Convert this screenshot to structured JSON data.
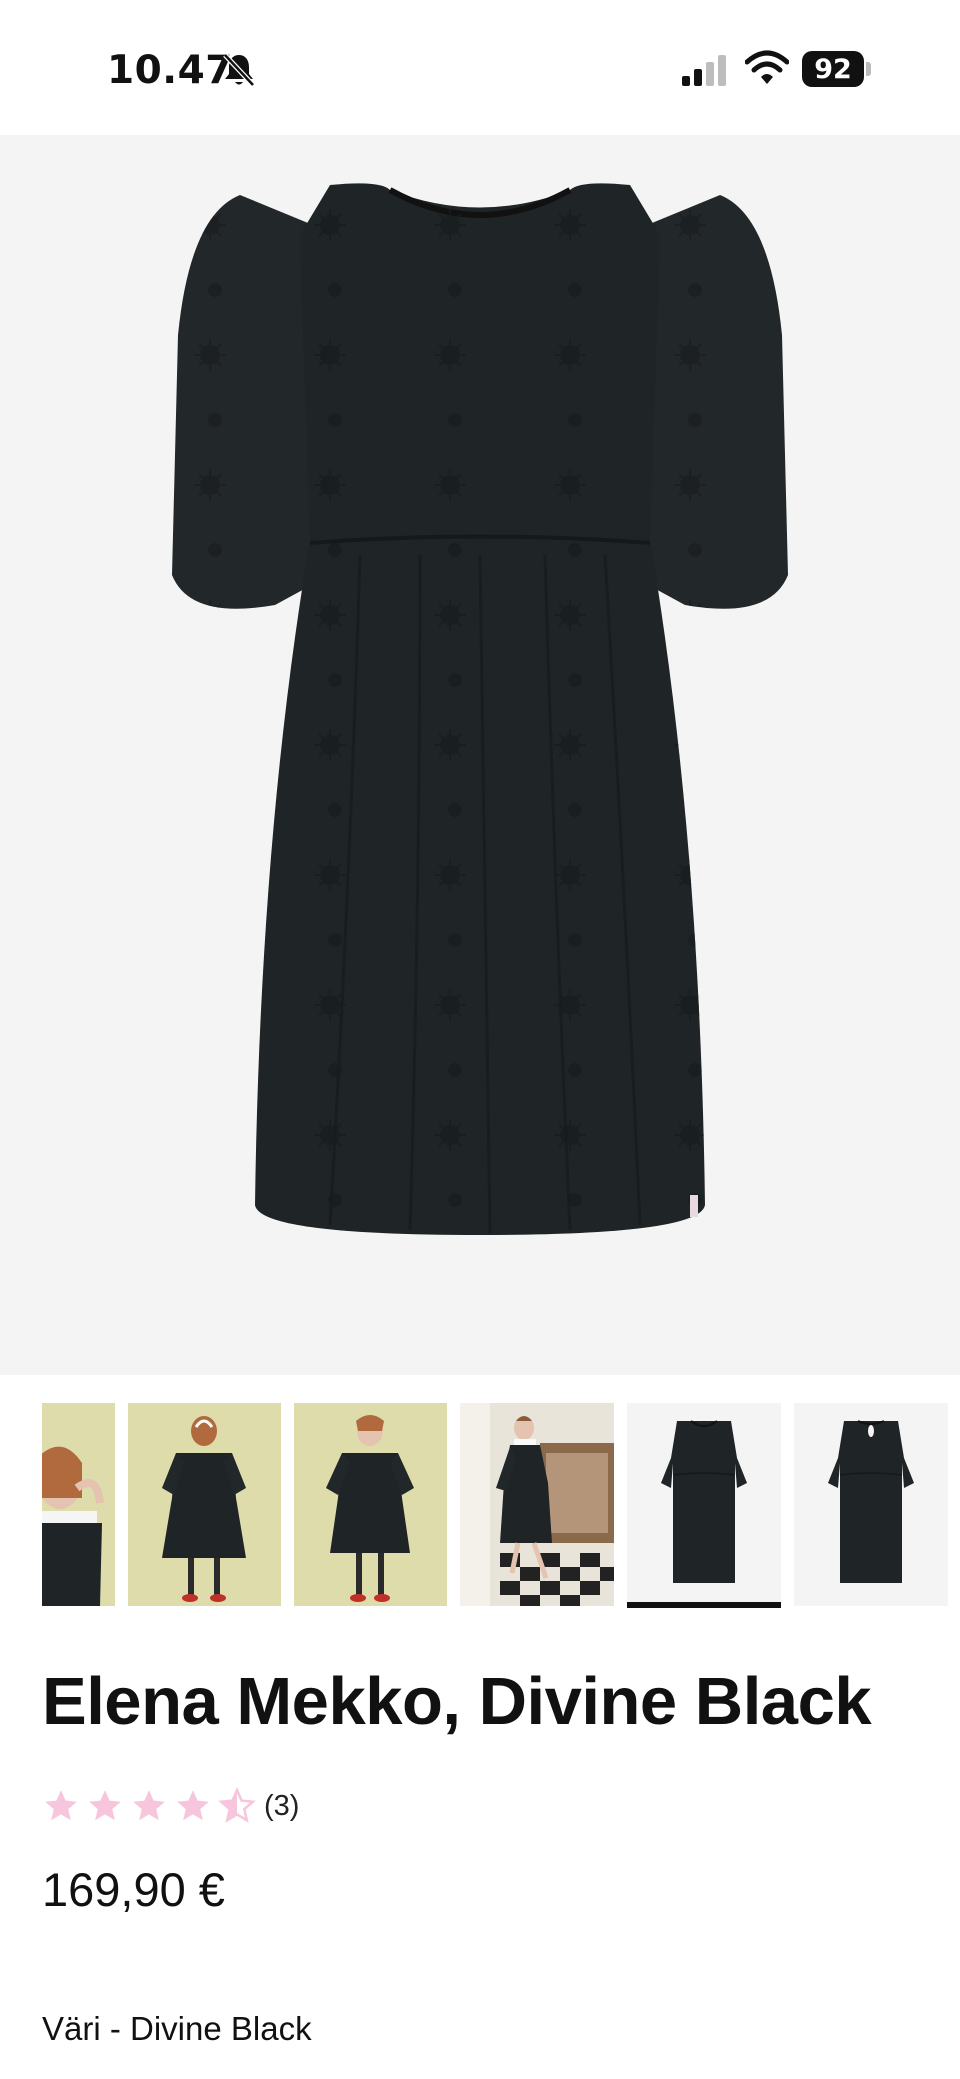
{
  "status_bar": {
    "time": "10.47",
    "battery": "92",
    "icons": [
      "bell-slash-icon",
      "signal-icon",
      "wifi-icon",
      "battery-icon"
    ]
  },
  "product": {
    "title": "Elena Mekko, Divine Black",
    "rating": {
      "value": 4.5,
      "max": 5,
      "count": "(3)",
      "star_color": "#f7c6dc"
    },
    "price": "169,90 €",
    "color_label": "Väri - Divine Black"
  },
  "gallery": {
    "thumbnail_count": 6,
    "selected_index": 4,
    "thumbnails": [
      "model-closeup",
      "model-back-view",
      "model-front-view",
      "model-interior",
      "dress-front",
      "dress-back"
    ]
  },
  "colors": {
    "dress": "#1f2426",
    "background_light": "#f4f4f4",
    "background_olive": "#dedcab",
    "star_pink": "#f7c6dc"
  }
}
